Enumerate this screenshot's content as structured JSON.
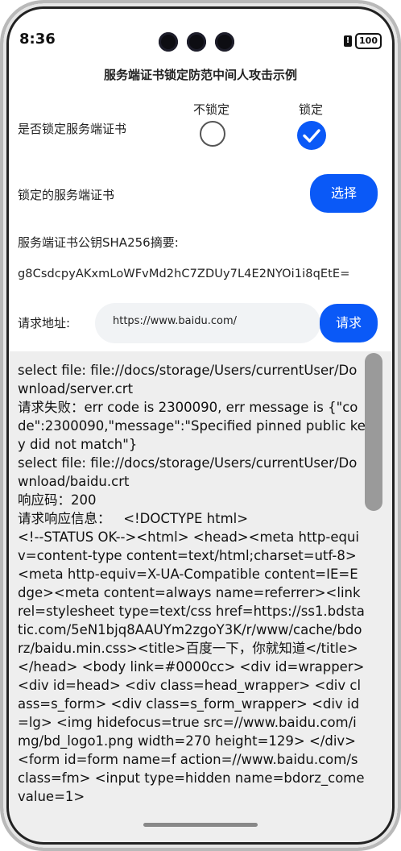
{
  "status_bar": {
    "time": "8:36",
    "battery": "100"
  },
  "app_title": "服务端证书锁定防范中间人攻击示例",
  "lock_setting": {
    "label": "是否锁定服务端证书",
    "options": [
      {
        "label": "不锁定",
        "checked": false
      },
      {
        "label": "锁定",
        "checked": true
      }
    ]
  },
  "cert_select": {
    "label": "锁定的服务端证书",
    "button_label": "选择"
  },
  "sha256": {
    "label": "服务端证书公钥SHA256摘要:",
    "value": "g8CsdcpyAKxmLoWFvMd2hC7ZDUy7L4E2NYOi1i8qEtE="
  },
  "request": {
    "label": "请求地址:",
    "url_value": "https://www.baidu.com/",
    "button_label": "请求"
  },
  "log_output": "select file: file://docs/storage/Users/currentUser/Download/server.crt\n请求失败：err code is 2300090, err message is {\"code\":2300090,\"message\":\"Specified pinned public key did not match\"}\nselect file: file://docs/storage/Users/currentUser/Download/baidu.crt\n响应码：200\n请求响应信息：   <!DOCTYPE html>\n<!--STATUS OK--><html> <head><meta http-equiv=content-type content=text/html;charset=utf-8><meta http-equiv=X-UA-Compatible content=IE=Edge><meta content=always name=referrer><link rel=stylesheet type=text/css href=https://ss1.bdstatic.com/5eN1bjq8AAUYm2zgoY3K/r/www/cache/bdorz/baidu.min.css><title>百度一下，你就知道</title></head> <body link=#0000cc> <div id=wrapper> <div id=head> <div class=head_wrapper> <div class=s_form> <div class=s_form_wrapper> <div id=lg> <img hidefocus=true src=//www.baidu.com/img/bd_logo1.png width=270 height=129> </div> <form id=form name=f action=//www.baidu.com/s class=fm> <input type=hidden name=bdorz_come value=1>",
  "colors": {
    "accent": "#0a59f7",
    "log_background": "#eeeeee",
    "input_background": "#f1f3f5"
  }
}
